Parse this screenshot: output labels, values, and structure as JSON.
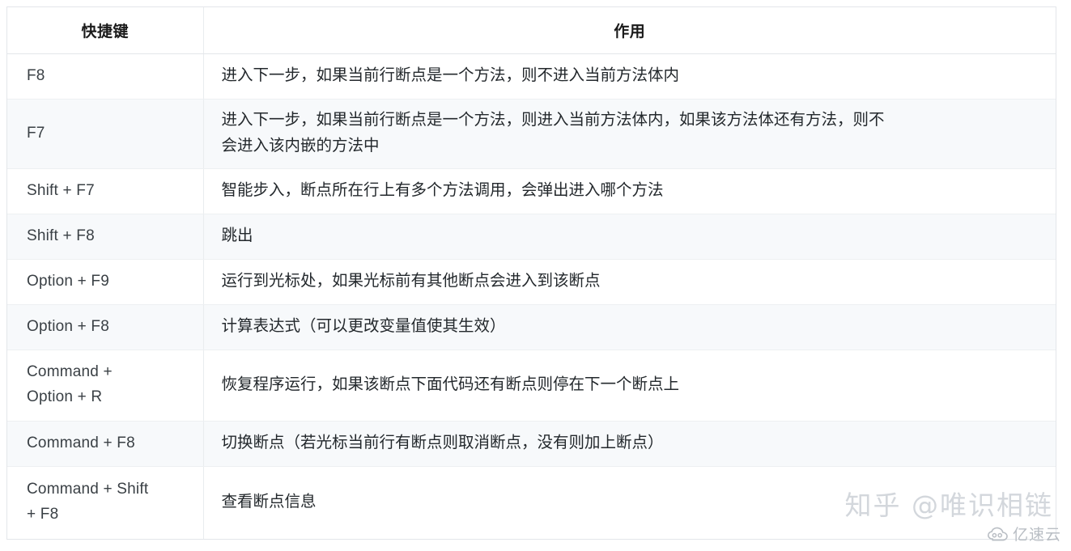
{
  "table": {
    "headers": {
      "key": "快捷键",
      "action": "作用"
    },
    "rows": [
      {
        "key": "F8",
        "desc": "进入下一步，如果当前行断点是一个方法，则不进入当前方法体内",
        "desc_line2": ""
      },
      {
        "key": "F7",
        "desc": "进入下一步，如果当前行断点是一个方法，则进入当前方法体内，如果该方法体还有方法，则不",
        "desc_line2": "会进入该内嵌的方法中"
      },
      {
        "key": "Shift + F7",
        "desc": "智能步入，断点所在行上有多个方法调用，会弹出进入哪个方法",
        "desc_line2": ""
      },
      {
        "key": "Shift + F8",
        "desc": "跳出",
        "desc_line2": ""
      },
      {
        "key": "Option + F9",
        "desc": "运行到光标处，如果光标前有其他断点会进入到该断点",
        "desc_line2": ""
      },
      {
        "key": "Option + F8",
        "desc": "计算表达式（可以更改变量值使其生效）",
        "desc_line2": ""
      },
      {
        "key": "Command +",
        "key_line2": "Option + R",
        "desc": "恢复程序运行，如果该断点下面代码还有断点则停在下一个断点上",
        "desc_line2": ""
      },
      {
        "key": "Command + F8",
        "desc": "切换断点（若光标当前行有断点则取消断点，没有则加上断点）",
        "desc_line2": ""
      },
      {
        "key": "Command + Shift",
        "key_line2": "+ F8",
        "desc": "查看断点信息",
        "desc_line2": ""
      }
    ]
  },
  "watermarks": {
    "zhihu": "知乎 @唯识相链",
    "site": "亿速云",
    "site_icon": "cloud-icon"
  },
  "colors": {
    "stripe": "#f7f9fb",
    "border": "#e9ecef",
    "text": "#23282c",
    "watermark": "#d3d7dc"
  }
}
